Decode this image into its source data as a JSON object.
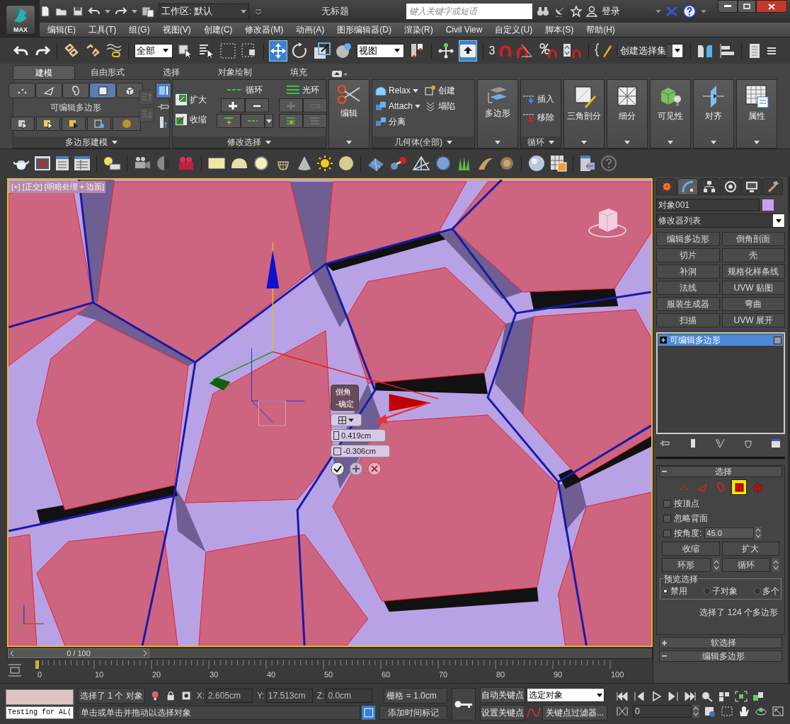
{
  "title_bar": {
    "logo_label": "MAX",
    "workspace": "工作区: 默认",
    "title": "无标题",
    "search": {
      "placeholder": "键入关键字或短语"
    },
    "login": "登录"
  },
  "menu": [
    "编辑(E)",
    "工具(T)",
    "组(G)",
    "视图(V)",
    "创建(C)",
    "修改器(M)",
    "动画(A)",
    "图形编辑器(D)",
    "渲染(R)",
    "Civil View",
    "自定义(U)",
    "脚本(S)",
    "帮助(H)"
  ],
  "main_toolbar": {
    "selection_filter": "全部",
    "reference_coord": "视图",
    "snap_label": "3",
    "named_selection": "创建选择集",
    "move_selected": true,
    "shortcut_override_on": true
  },
  "ribbon": {
    "tabs": [
      {
        "label": "建模",
        "selected": true
      },
      {
        "label": "自由形式",
        "selected": false
      },
      {
        "label": "选择",
        "selected": false
      },
      {
        "label": "对象绘制",
        "selected": false
      },
      {
        "label": "填充",
        "selected": false
      }
    ],
    "polygon_modeling": {
      "title": "可编辑多边形",
      "footer": "多边形建模",
      "subobjects": [
        {
          "kind": "vertex",
          "selected": false
        },
        {
          "kind": "edge",
          "selected": false
        },
        {
          "kind": "border",
          "selected": false
        },
        {
          "kind": "polygon",
          "selected": true
        },
        {
          "kind": "element",
          "selected": false
        }
      ],
      "show_cage_on": true
    },
    "modify_selection": {
      "footer": "修改选择",
      "grow": "扩大",
      "shrink": "收缩",
      "loop": "循环",
      "ring": "光环"
    },
    "edit": {
      "label": "编辑"
    },
    "geometry": {
      "footer": "几何体(全部)",
      "relax": "Relax",
      "attach": "Attach",
      "detach": "分离",
      "create": "创建",
      "collapse": "塌陷"
    },
    "polygons": {
      "label": "多边形"
    },
    "loops": {
      "footer": "循环",
      "insert": "插入",
      "remove": "移除"
    },
    "big_buttons": [
      {
        "kind": "triangulate",
        "label": "三角剖分"
      },
      {
        "kind": "subdivide",
        "label": "细分"
      },
      {
        "kind": "visibility",
        "label": "可见性"
      },
      {
        "kind": "align",
        "label": "对齐"
      },
      {
        "kind": "properties",
        "label": "属性"
      }
    ]
  },
  "viewport": {
    "label": "[+] [正交] [明暗处理 + 边面]",
    "caddy": {
      "title": "倒角",
      "subtitle": "-确定",
      "height": "0.419cm",
      "outline": "-0.306cm"
    }
  },
  "command_panel": {
    "tabs": [
      {
        "kind": "create",
        "selected": false
      },
      {
        "kind": "modify",
        "selected": true
      },
      {
        "kind": "hierarchy",
        "selected": false
      },
      {
        "kind": "motion",
        "selected": false
      },
      {
        "kind": "display",
        "selected": false
      },
      {
        "kind": "utilities",
        "selected": false
      }
    ],
    "object": {
      "name": "对象001",
      "color": "#c8a0f0"
    },
    "modifier_list": "修改器列表",
    "modifier_buttons": [
      "编辑多边形",
      "倒角剖面",
      "切片",
      "壳",
      "补洞",
      "规格化样条线",
      "法线",
      "UVW 贴图",
      "服装生成器",
      "弯曲",
      "扫描",
      "UVW 展开"
    ],
    "stack": [
      {
        "label": "可编辑多边形",
        "selected": true
      }
    ],
    "selection_rollout": {
      "title": "选择",
      "subobjects": [
        {
          "kind": "vertex",
          "selected": false
        },
        {
          "kind": "edge",
          "selected": false
        },
        {
          "kind": "border",
          "selected": false
        },
        {
          "kind": "polygon",
          "selected": true
        },
        {
          "kind": "element",
          "selected": false
        }
      ],
      "options": [
        {
          "label": "按顶点",
          "checked": false
        },
        {
          "label": "忽略背面",
          "checked": false
        },
        {
          "label": "按角度:",
          "checked": false,
          "value": "45.0"
        }
      ],
      "shrink": "收缩",
      "grow": "扩大",
      "ring": "环形",
      "loop": "循环",
      "preview_title": "预览选择",
      "preview_options": [
        {
          "label": "禁用",
          "selected": true
        },
        {
          "label": "子对象",
          "selected": false
        },
        {
          "label": "多个",
          "selected": false
        }
      ],
      "status": "选择了 124 个多边形"
    },
    "rollouts": [
      {
        "title": "软选择",
        "expanded": false
      },
      {
        "title": "编辑多边形",
        "expanded": true
      }
    ]
  },
  "timeline": {
    "frame_label": "0 / 100",
    "ticks": [
      "0",
      "10",
      "20",
      "30",
      "40",
      "50",
      "60",
      "70",
      "80",
      "90",
      "100"
    ]
  },
  "status_bar": {
    "script_listener": "Testing for AL(",
    "selection": "选择了 1 个 对象",
    "coords": [
      {
        "axis": "X:",
        "value": "2.605cm"
      },
      {
        "axis": "Y:",
        "value": "17.513cm"
      },
      {
        "axis": "Z:",
        "value": "0.0cm"
      }
    ],
    "grid": "栅格 = 1.0cm",
    "prompt": "单击或单击并拖动以选择对象",
    "add_time_tag": "添加时间标记",
    "auto_key": "自动关键点",
    "set_key": "设置关键点",
    "key_mode": "选定对象",
    "key_filters": "关键点过滤器...",
    "current_frame": "0"
  }
}
